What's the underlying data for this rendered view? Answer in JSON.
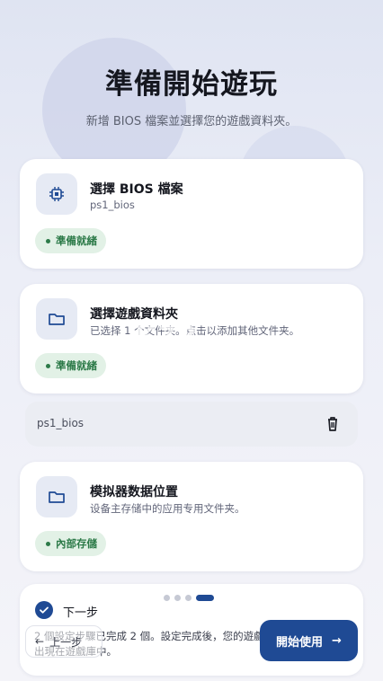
{
  "header": {
    "title": "準備開始遊玩",
    "subtitle": "新增 BIOS 檔案並選擇您的遊戲資料夾。"
  },
  "cards": [
    {
      "icon": "chip-icon",
      "title": "選擇 BIOS 檔案",
      "subtitle": "ps1_bios",
      "badge": "準備就緒"
    },
    {
      "icon": "folder-icon",
      "title": "選擇遊戲資料夾",
      "subtitle": "已选择 1 个文件夹。点击以添加其他文件夹。",
      "badge": "準備就緒"
    },
    {
      "icon": "folder-icon",
      "title": "模拟器数据位置",
      "subtitle": "设备主存储中的应用专用文件夹。",
      "badge": "內部存儲"
    }
  ],
  "file_row": {
    "name": "ps1_bios",
    "icon": "trash-icon"
  },
  "pager": {
    "total": 4,
    "active": 4
  },
  "footer": {
    "next_label": "下一步",
    "status_text": "2 個設定步驟已完成 2 個。設定完成後，您的遊戲將出現在遊戲庫中。",
    "prev_label": "上一步",
    "start_label": "開始使用"
  },
  "watermark": {
    "text": "K73",
    "small": "游戏之家"
  },
  "colors": {
    "accent": "#1f4a94",
    "ready": "#2c7a48",
    "ready_bg": "#e2f1e6"
  }
}
